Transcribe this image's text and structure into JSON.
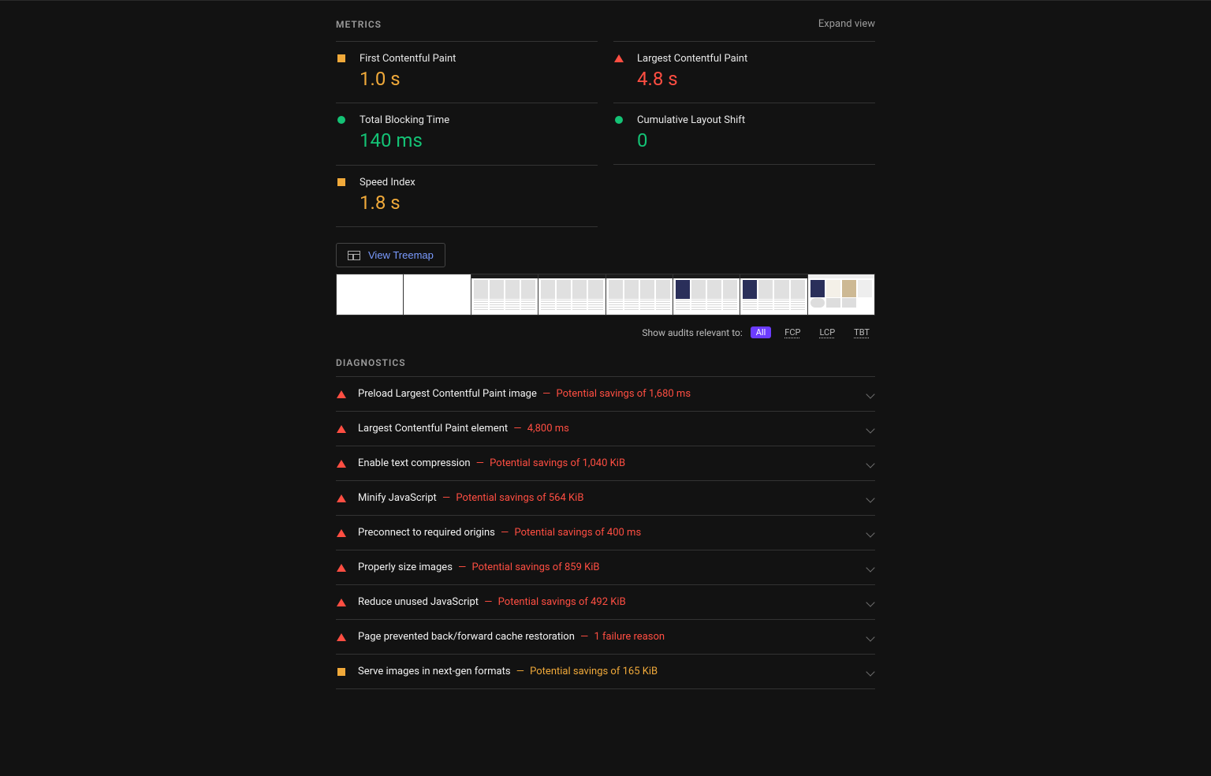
{
  "metrics": {
    "section_title": "METRICS",
    "expand_label": "Expand view",
    "items": [
      {
        "label": "First Contentful Paint",
        "value": "1.0 s",
        "status": "avg"
      },
      {
        "label": "Largest Contentful Paint",
        "value": "4.8 s",
        "status": "fail"
      },
      {
        "label": "Total Blocking Time",
        "value": "140 ms",
        "status": "pass"
      },
      {
        "label": "Cumulative Layout Shift",
        "value": "0",
        "status": "pass"
      },
      {
        "label": "Speed Index",
        "value": "1.8 s",
        "status": "avg"
      }
    ]
  },
  "treemap_label": "View Treemap",
  "filter": {
    "prompt": "Show audits relevant to:",
    "options": [
      "All",
      "FCP",
      "LCP",
      "TBT"
    ],
    "active": "All"
  },
  "diagnostics": {
    "section_title": "DIAGNOSTICS",
    "items": [
      {
        "status": "fail",
        "title": "Preload Largest Contentful Paint image",
        "saving": "Potential savings of 1,680 ms"
      },
      {
        "status": "fail",
        "title": "Largest Contentful Paint element",
        "saving": "4,800 ms"
      },
      {
        "status": "fail",
        "title": "Enable text compression",
        "saving": "Potential savings of 1,040 KiB"
      },
      {
        "status": "fail",
        "title": "Minify JavaScript",
        "saving": "Potential savings of 564 KiB"
      },
      {
        "status": "fail",
        "title": "Preconnect to required origins",
        "saving": "Potential savings of 400 ms"
      },
      {
        "status": "fail",
        "title": "Properly size images",
        "saving": "Potential savings of 859 KiB"
      },
      {
        "status": "fail",
        "title": "Reduce unused JavaScript",
        "saving": "Potential savings of 492 KiB"
      },
      {
        "status": "fail",
        "title": "Page prevented back/forward cache restoration",
        "saving": "1 failure reason"
      },
      {
        "status": "avg",
        "title": "Serve images in next-gen formats",
        "saving": "Potential savings of 165 KiB"
      }
    ]
  },
  "colors": {
    "pass": "#14c275",
    "avg": "#f0a93a",
    "fail": "#ff4e42",
    "accent": "#6c3cff",
    "link": "#7a9bff"
  }
}
